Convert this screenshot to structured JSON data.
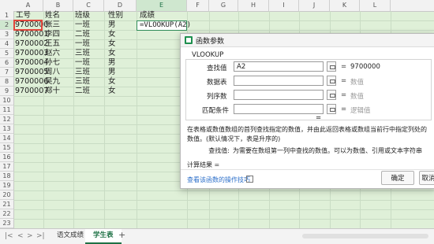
{
  "columns": [
    "A",
    "B",
    "C",
    "D",
    "E",
    "F",
    "G",
    "H",
    "I",
    "J",
    "K",
    "L"
  ],
  "rows": [
    "1",
    "2",
    "3",
    "4",
    "5",
    "6",
    "7",
    "8",
    "9",
    "10",
    "11",
    "12",
    "13",
    "14",
    "15",
    "16",
    "17",
    "18",
    "19",
    "20",
    "21",
    "22",
    "23"
  ],
  "headers": {
    "a": "工号",
    "b": "姓名",
    "c": "班级",
    "d": "性别",
    "e": "成绩"
  },
  "records": [
    {
      "id": "9700000",
      "name": "张三",
      "cls": "一班",
      "sex": "男"
    },
    {
      "id": "9700001",
      "name": "李四",
      "cls": "二班",
      "sex": "女"
    },
    {
      "id": "9700002",
      "name": "王五",
      "cls": "一班",
      "sex": "女"
    },
    {
      "id": "9700003",
      "name": "赵六",
      "cls": "三班",
      "sex": "女"
    },
    {
      "id": "9700004",
      "name": "孙七",
      "cls": "一班",
      "sex": "男"
    },
    {
      "id": "9700005",
      "name": "周八",
      "cls": "三班",
      "sex": "男"
    },
    {
      "id": "9700006",
      "name": "吴九",
      "cls": "三班",
      "sex": "女"
    },
    {
      "id": "9700007",
      "name": "郑十",
      "cls": "二班",
      "sex": "女"
    }
  ],
  "formula": "=VLOOKUP(A2)",
  "dialog": {
    "title": "函数参数",
    "function_name": "VLOOKUP",
    "args": [
      {
        "label": "查找值",
        "value": "A2",
        "result": "9700000"
      },
      {
        "label": "数据表",
        "value": "",
        "result": "数值"
      },
      {
        "label": "列序数",
        "value": "",
        "result": "数值"
      },
      {
        "label": "匹配条件",
        "value": "",
        "result": "逻辑值"
      }
    ],
    "equals_sign": "=",
    "description": "在表格或数值数组的首列查找指定的数值，并由此返回表格或数组当前行中指定列处的数值。(默认情况下，表是升序的)",
    "param_key": "查找值:",
    "param_desc": "为需要在数组第一列中查找的数值。可以为数值、引用或文本字符串",
    "calc_result": "计算结果 =",
    "help_link": "查看该函数的操作技巧",
    "ok_label": "确定",
    "cancel_label": "取消"
  },
  "sheet_tabs": {
    "tab1": "语文成绩",
    "tab2": "学生表",
    "add": "+"
  },
  "nav": {
    "first": "|<",
    "prev": "<",
    "next": ">",
    "last": ">|"
  },
  "colors": {
    "grid_bg": "#dff0d8",
    "active_tab": "#1e7145",
    "selection": "#e0463c"
  }
}
